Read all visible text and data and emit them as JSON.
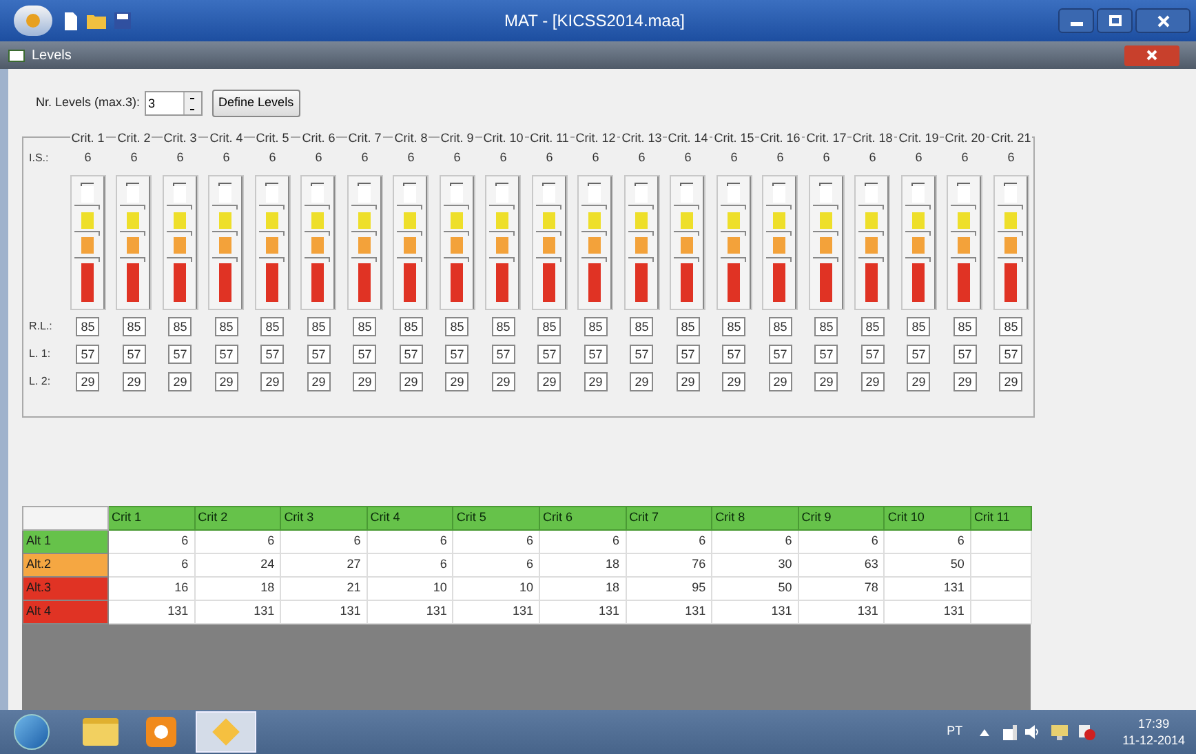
{
  "window": {
    "title": "MAT - [KICSS2014.maa]"
  },
  "levels_window": {
    "title": "Levels"
  },
  "levels_setup": {
    "label": "Nr. Levels (max.3):",
    "value": "3",
    "button": "Define Levels"
  },
  "criteria_panel": {
    "row_labels": [
      "I.S.:",
      "R.L.:",
      "L. 1:",
      "L. 2:"
    ],
    "criteria": [
      {
        "name": "Crit. 1",
        "is": "6",
        "rl": "85",
        "l1": "57",
        "l2": "29"
      },
      {
        "name": "Crit. 2",
        "is": "6",
        "rl": "85",
        "l1": "57",
        "l2": "29"
      },
      {
        "name": "Crit. 3",
        "is": "6",
        "rl": "85",
        "l1": "57",
        "l2": "29"
      },
      {
        "name": "Crit. 4",
        "is": "6",
        "rl": "85",
        "l1": "57",
        "l2": "29"
      },
      {
        "name": "Crit. 5",
        "is": "6",
        "rl": "85",
        "l1": "57",
        "l2": "29"
      },
      {
        "name": "Crit. 6",
        "is": "6",
        "rl": "85",
        "l1": "57",
        "l2": "29"
      },
      {
        "name": "Crit. 7",
        "is": "6",
        "rl": "85",
        "l1": "57",
        "l2": "29"
      },
      {
        "name": "Crit. 8",
        "is": "6",
        "rl": "85",
        "l1": "57",
        "l2": "29"
      },
      {
        "name": "Crit. 9",
        "is": "6",
        "rl": "85",
        "l1": "57",
        "l2": "29"
      },
      {
        "name": "Crit. 10",
        "is": "6",
        "rl": "85",
        "l1": "57",
        "l2": "29"
      },
      {
        "name": "Crit. 11",
        "is": "6",
        "rl": "85",
        "l1": "57",
        "l2": "29"
      },
      {
        "name": "Crit. 12",
        "is": "6",
        "rl": "85",
        "l1": "57",
        "l2": "29"
      },
      {
        "name": "Crit. 13",
        "is": "6",
        "rl": "85",
        "l1": "57",
        "l2": "29"
      },
      {
        "name": "Crit. 14",
        "is": "6",
        "rl": "85",
        "l1": "57",
        "l2": "29"
      },
      {
        "name": "Crit. 15",
        "is": "6",
        "rl": "85",
        "l1": "57",
        "l2": "29"
      },
      {
        "name": "Crit. 16",
        "is": "6",
        "rl": "85",
        "l1": "57",
        "l2": "29"
      },
      {
        "name": "Crit. 17",
        "is": "6",
        "rl": "85",
        "l1": "57",
        "l2": "29"
      },
      {
        "name": "Crit. 18",
        "is": "6",
        "rl": "85",
        "l1": "57",
        "l2": "29"
      },
      {
        "name": "Crit. 19",
        "is": "6",
        "rl": "85",
        "l1": "57",
        "l2": "29"
      },
      {
        "name": "Crit. 20",
        "is": "6",
        "rl": "85",
        "l1": "57",
        "l2": "29"
      },
      {
        "name": "Crit. 21",
        "is": "6",
        "rl": "85",
        "l1": "57",
        "l2": "29"
      }
    ]
  },
  "table": {
    "columns": [
      "Crit 1",
      "Crit 2",
      "Crit 3",
      "Crit 4",
      "Crit 5",
      "Crit 6",
      "Crit 7",
      "Crit 8",
      "Crit 9",
      "Crit 10",
      "Crit 11"
    ],
    "rows": [
      {
        "label": "Alt 1",
        "color": "#66c24a",
        "cells": [
          "6",
          "6",
          "6",
          "6",
          "6",
          "6",
          "6",
          "6",
          "6",
          "6"
        ]
      },
      {
        "label": "Alt.2",
        "color": "#f5a742",
        "cells": [
          "6",
          "24",
          "27",
          "6",
          "6",
          "18",
          "76",
          "30",
          "63",
          "50"
        ]
      },
      {
        "label": "Alt.3",
        "color": "#e03324",
        "cells": [
          "16",
          "18",
          "21",
          "10",
          "10",
          "18",
          "95",
          "50",
          "78",
          "131"
        ]
      },
      {
        "label": "Alt 4",
        "color": "#e03324",
        "cells": [
          "131",
          "131",
          "131",
          "131",
          "131",
          "131",
          "131",
          "131",
          "131",
          "131"
        ]
      }
    ]
  },
  "taskbar": {
    "language": "PT",
    "time": "17:39",
    "date": "11-12-2014"
  }
}
